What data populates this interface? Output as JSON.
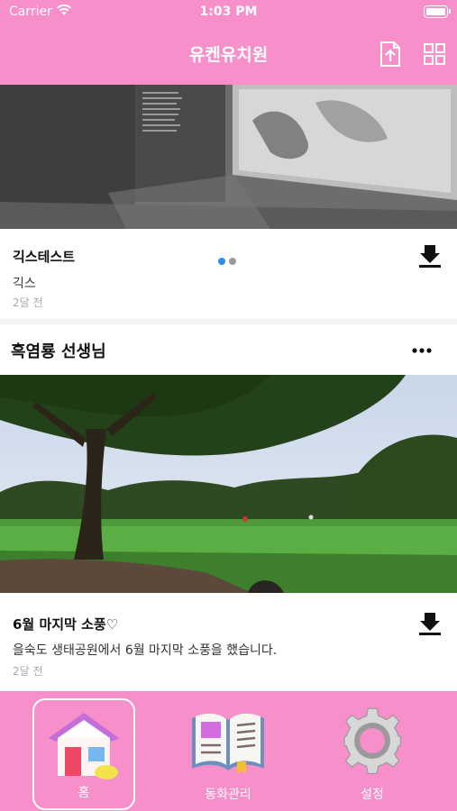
{
  "status_bar": {
    "carrier": "Carrier",
    "time": "1:03 PM"
  },
  "nav": {
    "title": "유켄유치원",
    "upload_icon": "upload-icon",
    "grid_icon": "grid-icon"
  },
  "post1": {
    "title": "긱스테스트",
    "description": "긱스",
    "time": "2달 전",
    "carousel_pages": 2,
    "carousel_active": 1
  },
  "section": {
    "name": "흑염룡 선생님"
  },
  "post2": {
    "title": "6월 마지막 소풍♡",
    "description": "을숙도 생태공원에서 6월 마지막 소풍을 했습니다.",
    "time": "2달 전"
  },
  "tabbar": {
    "tabs": [
      {
        "label": "홈",
        "icon": "house-icon",
        "active": true
      },
      {
        "label": "동화관리",
        "icon": "book-icon",
        "active": false
      },
      {
        "label": "설정",
        "icon": "gear-icon",
        "active": false
      }
    ]
  },
  "colors": {
    "brand": "#f78fca",
    "dot_active": "#2f8de4",
    "dot_inactive": "#9a9a9a"
  }
}
